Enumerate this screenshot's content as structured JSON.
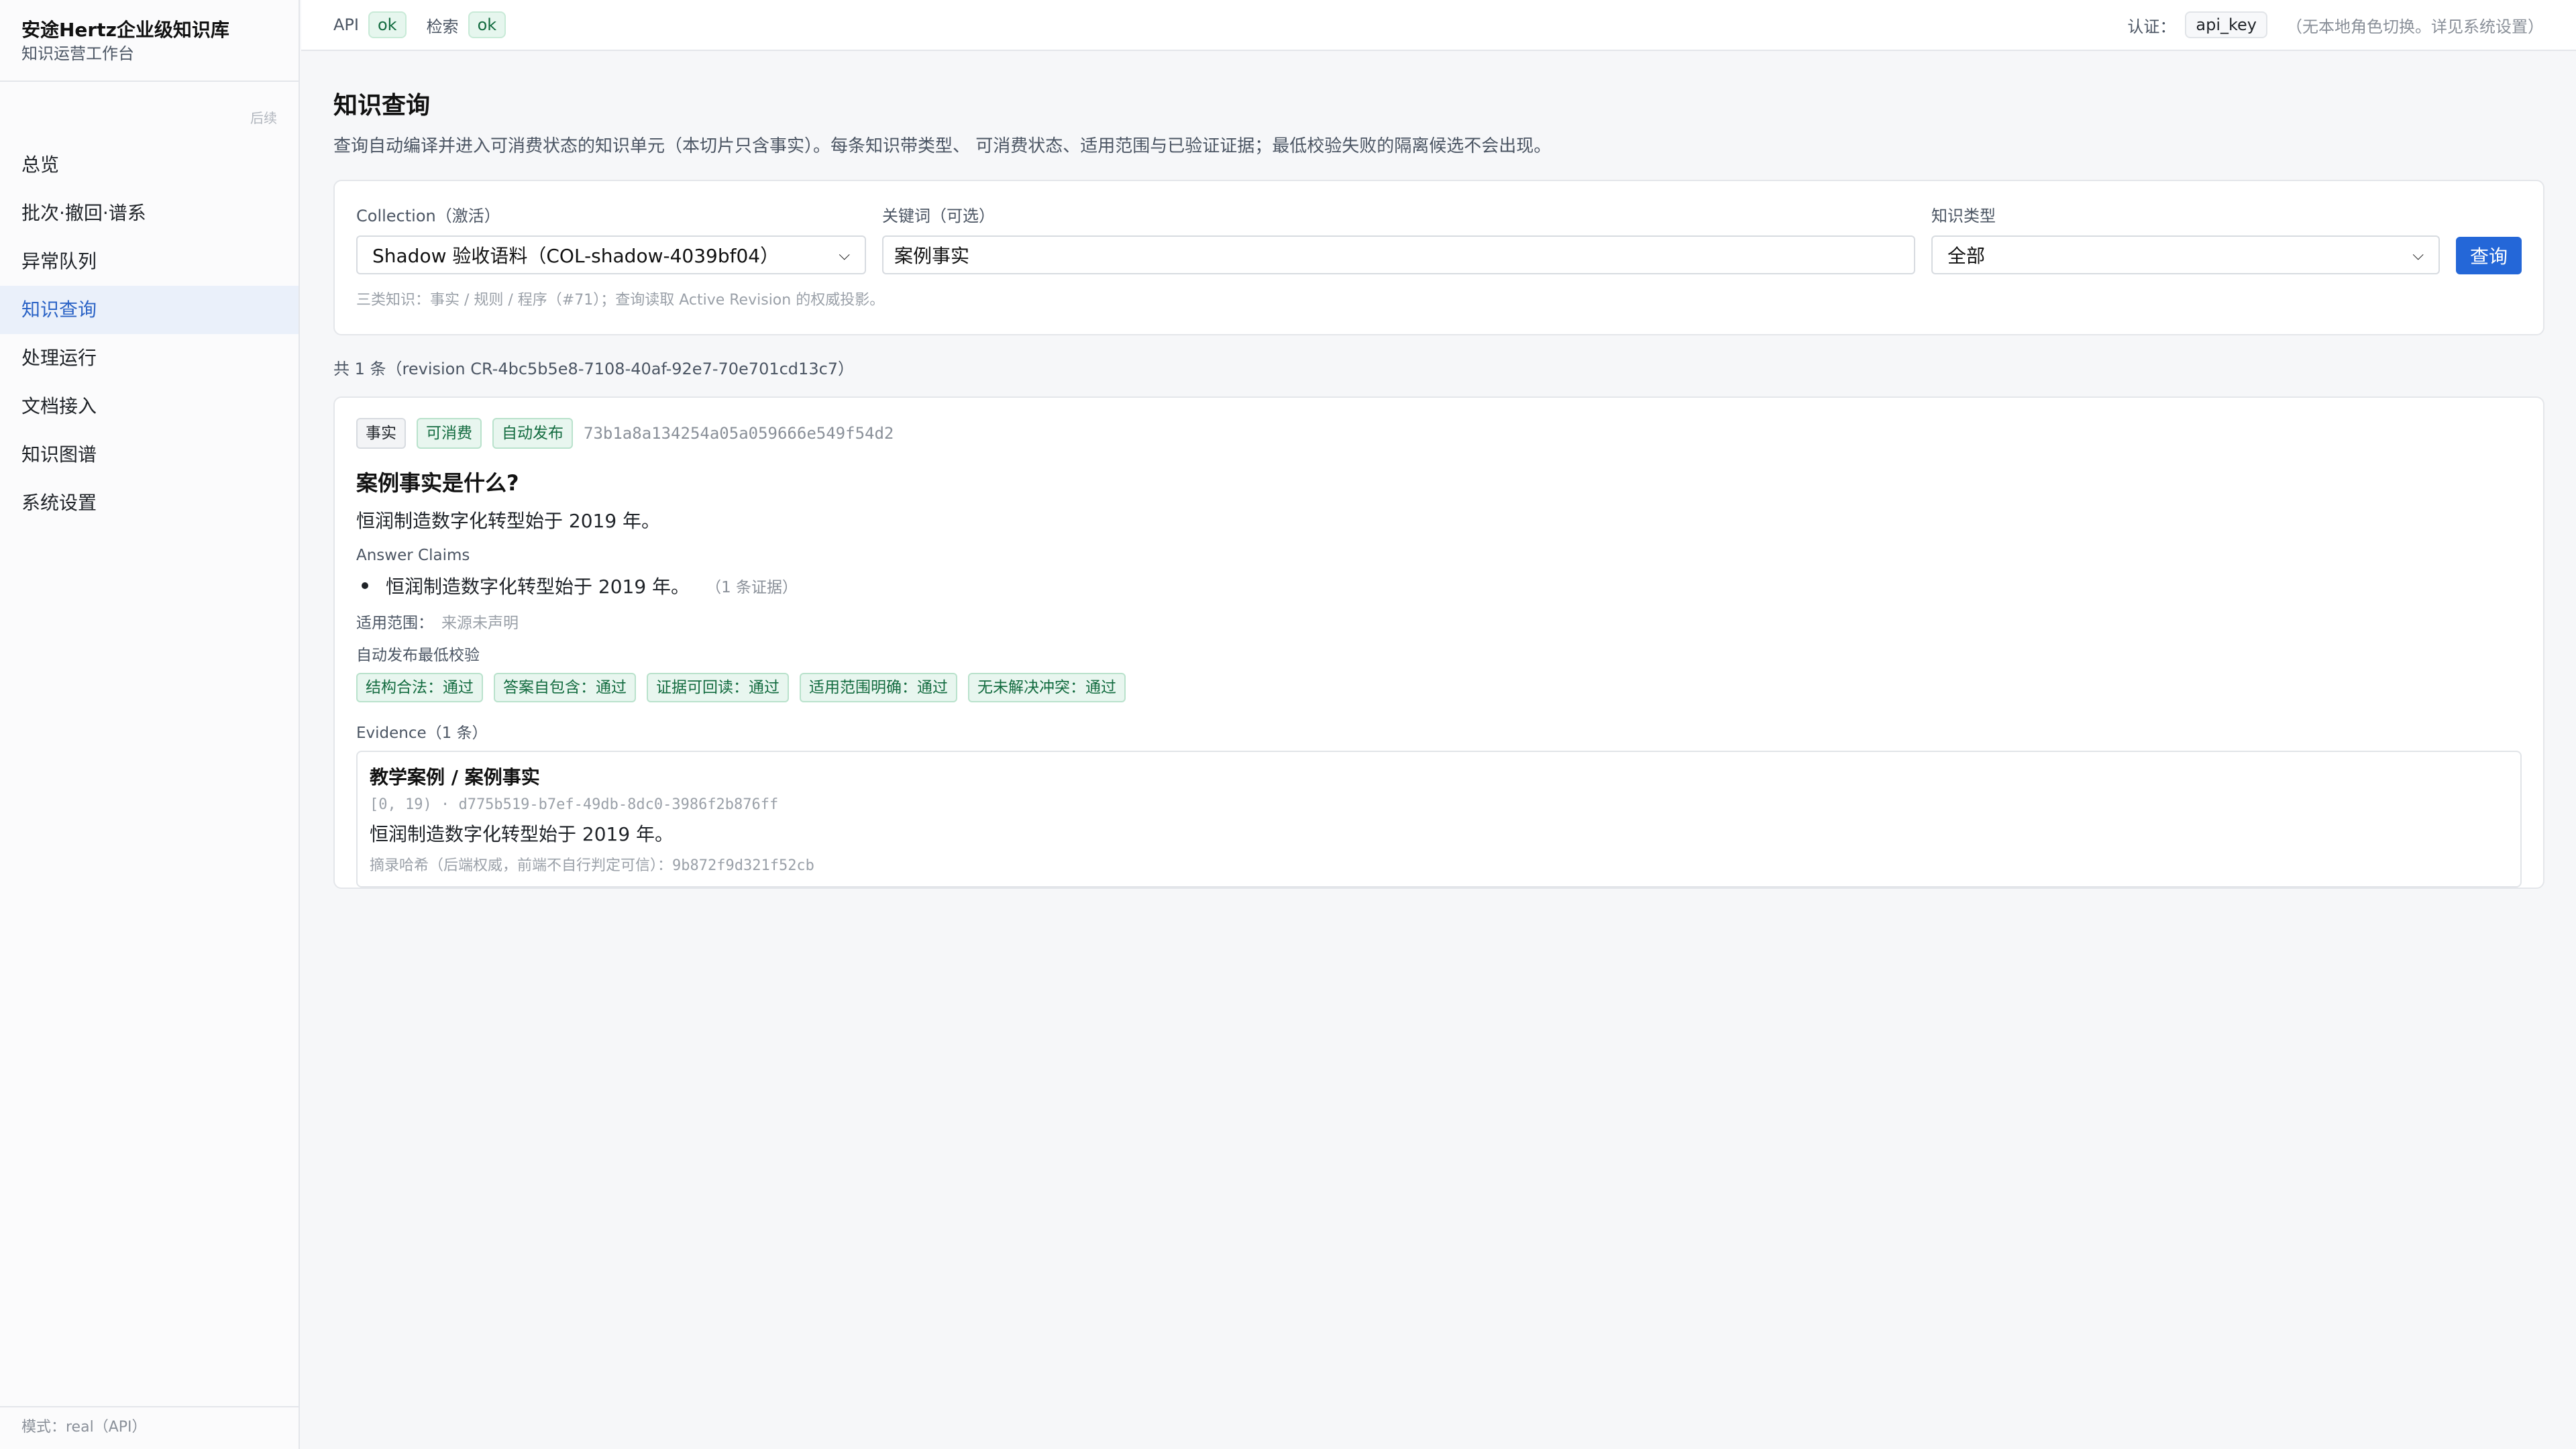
{
  "sidebar": {
    "brand_title": "安途Hertz企业级知识库",
    "brand_sub": "知识运营工作台",
    "collapse_label": "后续",
    "items": [
      {
        "label": "总览"
      },
      {
        "label": "批次·撤回·谱系"
      },
      {
        "label": "异常队列"
      },
      {
        "label": "知识查询",
        "active": true
      },
      {
        "label": "处理运行"
      },
      {
        "label": "文档接入"
      },
      {
        "label": "知识图谱"
      },
      {
        "label": "系统设置"
      }
    ],
    "mode": "模式：real（API）"
  },
  "topbar": {
    "api_label": "API",
    "api_status": "ok",
    "search_label": "检索",
    "search_status": "ok",
    "auth_label": "认证：",
    "auth_value": "api_key",
    "auth_note": "（无本地角色切换。详见系统设置）"
  },
  "page": {
    "title": "知识查询",
    "description": "查询自动编译并进入可消费状态的知识单元（本切片只含事实）。每条知识带类型、 可消费状态、适用范围与已验证证据；最低校验失败的隔离候选不会出现。"
  },
  "filters": {
    "collection_label": "Collection（激活）",
    "collection_value": "Shadow 验收语料（COL-shadow-4039bf04）",
    "keyword_label": "关键词（可选）",
    "keyword_value": "案例事实",
    "type_label": "知识类型",
    "type_value": "全部",
    "query_button": "查询",
    "hint": "三类知识：事实 / 规则 / 程序（#71）；查询读取 Active Revision 的权威投影。"
  },
  "results": {
    "count_line": "共 1 条（revision CR-4bc5b5e8-7108-40af-92e7-70e701cd13c7）",
    "items": [
      {
        "tags": [
          "事实",
          "可消费",
          "自动发布"
        ],
        "hash": "73b1a8a134254a05a059666e549f54d2",
        "question": "案例事实是什么?",
        "answer": "恒润制造数字化转型始于 2019 年。",
        "claims_label": "Answer Claims",
        "claim": "恒润制造数字化转型始于 2019 年。",
        "claim_evidence": "（1 条证据）",
        "scope_label": "适用范围：",
        "scope_value": "来源未声明",
        "checks_label": "自动发布最低校验",
        "checks": [
          "结构合法：通过",
          "答案自包含：通过",
          "证据可回读：通过",
          "适用范围明确：通过",
          "无未解决冲突：通过"
        ],
        "evidence_label": "Evidence（1 条）",
        "evidence": {
          "title": "教学案例 / 案例事实",
          "span": "[0, 19) · d775b519-b7ef-49db-8dc0-3986f2b876ff",
          "text": "恒润制造数字化转型始于 2019 年。",
          "digest": "摘录哈希（后端权威，前端不自行判定可信）：9b872f9d321f52cb"
        }
      }
    ]
  }
}
